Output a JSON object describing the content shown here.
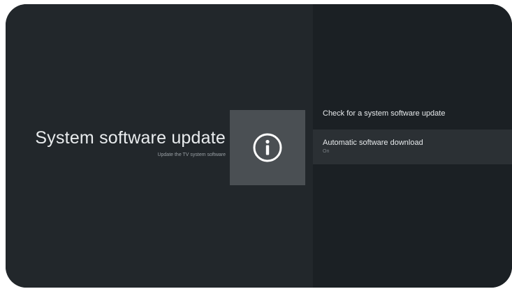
{
  "page": {
    "title": "System software update",
    "subtitle": "Update the TV system software",
    "icon": "info-icon"
  },
  "menu": {
    "items": [
      {
        "label": "Check for a system software update"
      },
      {
        "label": "Automatic software download",
        "value": "On"
      }
    ]
  },
  "colors": {
    "background": "#1f2428",
    "left_panel": "#22272b",
    "right_panel": "#1b2024",
    "icon_tile": "#4a4f53",
    "selected_item": "#2b3034",
    "text_primary": "#e9ecee",
    "text_secondary": "#9aa0a5"
  }
}
